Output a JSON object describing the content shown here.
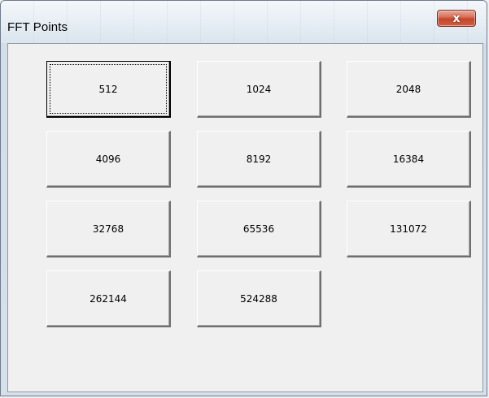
{
  "window": {
    "title": "FFT Points",
    "close_label": "x"
  },
  "buttons": [
    {
      "label": "512",
      "focused": true
    },
    {
      "label": "1024"
    },
    {
      "label": "2048"
    },
    {
      "label": "4096"
    },
    {
      "label": "8192"
    },
    {
      "label": "16384"
    },
    {
      "label": "32768"
    },
    {
      "label": "65536"
    },
    {
      "label": "131072"
    },
    {
      "label": "262144"
    },
    {
      "label": "524288"
    }
  ],
  "colors": {
    "close_button": "#c6452b",
    "face": "#f0f0f0"
  }
}
